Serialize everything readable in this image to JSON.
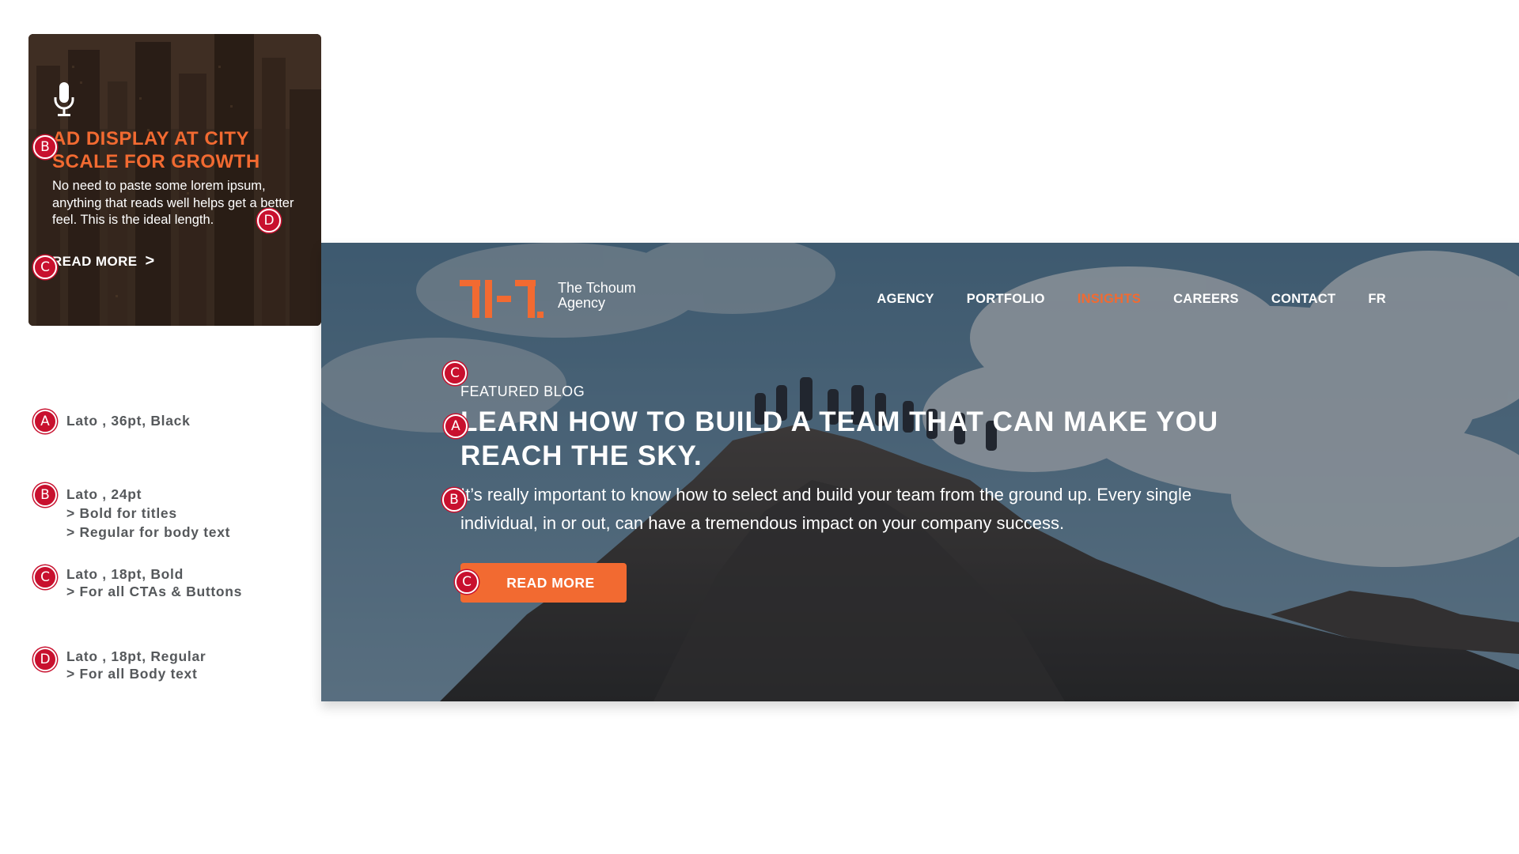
{
  "colors": {
    "accent": "#f26a31",
    "badge": "#c8102e",
    "legend_text": "#55585b"
  },
  "card": {
    "icon": "microphone-icon",
    "title": "AD DISPLAY AT CITY SCALE FOR GROWTH",
    "body": "No need to paste some lorem ipsum, anything that reads well helps get a better feel. This is the ideal length.",
    "cta_label": "READ MORE",
    "cta_chevron": ">"
  },
  "badges": {
    "a": "A",
    "b": "B",
    "c": "C",
    "d": "D"
  },
  "legend": {
    "a": {
      "line1": "Lato , 36pt, Black"
    },
    "b": {
      "line1": "Lato , 24pt",
      "line2": "> Bold for titles",
      "line3": "> Regular for body text"
    },
    "c": {
      "line1": "Lato , 18pt, Bold",
      "line2": "> For all CTAs & Buttons"
    },
    "d": {
      "line1": "Lato , 18pt, Regular",
      "line2": "> For all Body text"
    }
  },
  "hero": {
    "logo_line1": "The Tchoum",
    "logo_line2": "Agency",
    "nav": {
      "agency": "AGENCY",
      "portfolio": "PORTFOLIO",
      "insights": "INSIGHTS",
      "careers": "CAREERS",
      "contact": "CONTACT",
      "lang": "FR"
    },
    "active_nav": "INSIGHTS",
    "kicker": "FEATURED BLOG",
    "title": "LEARN HOW TO BUILD A TEAM THAT CAN MAKE YOU REACH THE SKY.",
    "body": "It’s really important to know how to select and build your team from the ground up. Every single individual, in or out, can have a tremendous impact on your company success.",
    "cta_label": "READ MORE"
  }
}
